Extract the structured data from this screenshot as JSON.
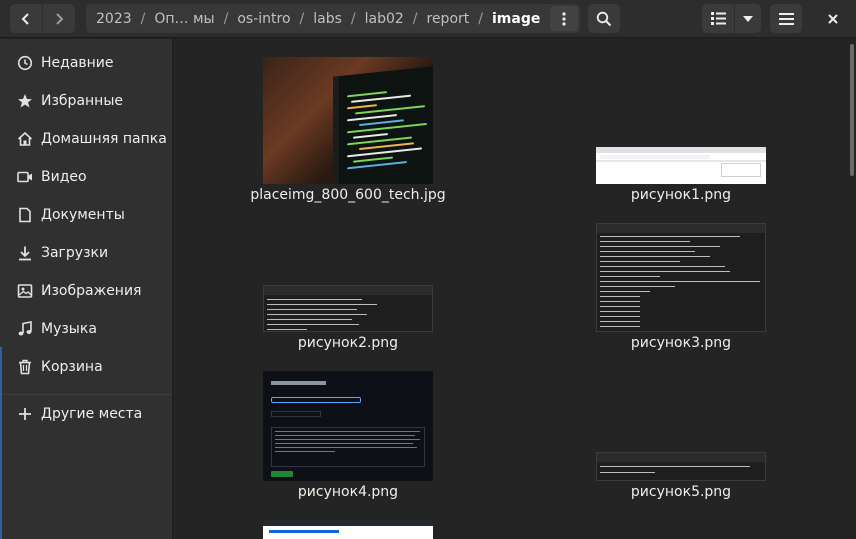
{
  "header": {
    "path": [
      "2023",
      "Оп… мы",
      "os-intro",
      "labs",
      "lab02",
      "report",
      "image"
    ],
    "current": "image",
    "icons": {
      "back": "chevron-left-icon",
      "forward": "chevron-right-icon",
      "more": "vertical-dots-icon",
      "search": "search-icon",
      "list_view": "list-view-icon",
      "view_dropdown": "triangle-down-icon",
      "menu": "hamburger-icon",
      "close": "close-icon"
    }
  },
  "sidebar": {
    "items": [
      {
        "label": "Недавние",
        "icon": "clock-icon"
      },
      {
        "label": "Избранные",
        "icon": "star-icon"
      },
      {
        "label": "Домашняя папка",
        "icon": "home-icon"
      },
      {
        "label": "Видео",
        "icon": "video-icon"
      },
      {
        "label": "Документы",
        "icon": "document-icon"
      },
      {
        "label": "Загрузки",
        "icon": "download-icon"
      },
      {
        "label": "Изображения",
        "icon": "image-icon"
      },
      {
        "label": "Музыка",
        "icon": "music-icon"
      },
      {
        "label": "Корзина",
        "icon": "trash-icon"
      }
    ],
    "other_places": {
      "label": "Другие места",
      "icon": "plus-icon"
    }
  },
  "files": [
    {
      "name": "placeimg_800_600_tech.jpg"
    },
    {
      "name": "рисунок1.png"
    },
    {
      "name": "рисунок2.png"
    },
    {
      "name": "рисунок3.png"
    },
    {
      "name": "рисунок4.png"
    },
    {
      "name": "рисунок5.png"
    },
    {
      "name": ""
    }
  ],
  "colors": {
    "window_bg": "#242424",
    "sidebar_bg": "#303030",
    "header_bg": "#2d2d2d",
    "text": "#eeeeec"
  }
}
